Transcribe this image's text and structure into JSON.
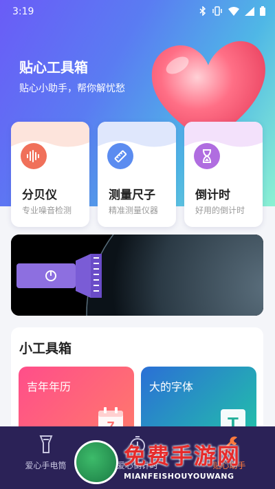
{
  "status_bar": {
    "time": "3:19"
  },
  "header": {
    "title": "贴心工具箱",
    "subtitle": "贴心小助手，帮你解忧愁"
  },
  "tool_cards": [
    {
      "name": "分贝仪",
      "desc": "专业噪音检测",
      "icon": "sound-wave-icon",
      "color": "#f0705a"
    },
    {
      "name": "测量尺子",
      "desc": "精准测量仪器",
      "icon": "ruler-icon",
      "color": "#5b8cf0"
    },
    {
      "name": "倒计时",
      "desc": "好用的倒计时",
      "icon": "hourglass-icon",
      "color": "#b06de0"
    }
  ],
  "banner": {
    "icon": "flashlight-icon"
  },
  "toolbox": {
    "title": "小工具箱",
    "items": [
      {
        "title": "吉年年历",
        "icon": "calendar-icon",
        "icon_text": "7"
      },
      {
        "title": "大的字体",
        "icon": "text-icon",
        "icon_text": "T"
      }
    ]
  },
  "tabbar": {
    "items": [
      {
        "label": "爱心手电筒",
        "icon": "flashlight-icon"
      },
      {
        "label": "爱心倒计时",
        "icon": "timer-icon"
      },
      {
        "label": "贴心助手",
        "icon": "tools-icon"
      }
    ]
  },
  "watermark": {
    "big": "免费手游网",
    "small": "MIANFEISHOUYOUWANG"
  }
}
